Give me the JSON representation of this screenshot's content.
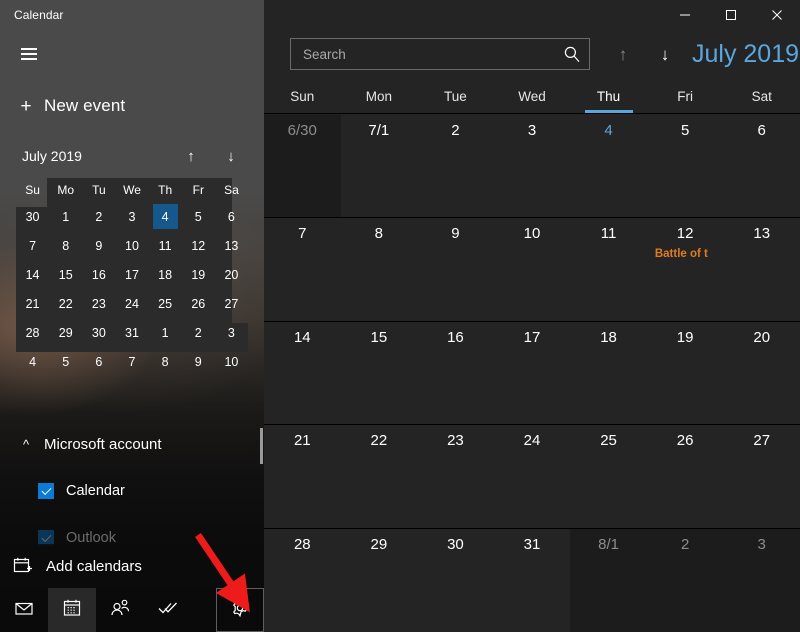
{
  "app": {
    "title": "Calendar",
    "menu_icon": "hamburger-icon",
    "new_event_label": "New event",
    "new_event_icon": "plus-icon"
  },
  "window_controls": {
    "minimize": "—",
    "maximize": "□",
    "close": "✕"
  },
  "search": {
    "placeholder": "Search",
    "value": "",
    "icon": "search-icon"
  },
  "header": {
    "prev_icon": "arrow-up-icon",
    "next_icon": "arrow-down-icon",
    "month_title": "July 2019",
    "accent_color": "#5aa7e0"
  },
  "mini_calendar": {
    "title": "July 2019",
    "prev_icon": "arrow-up-icon",
    "next_icon": "arrow-down-icon",
    "prev_glyph": "↑",
    "next_glyph": "↓",
    "weekdays": [
      "Su",
      "Mo",
      "Tu",
      "We",
      "Th",
      "Fr",
      "Sa"
    ],
    "today": "4",
    "today_color": "#17588c",
    "weeks": [
      [
        {
          "d": "30",
          "cur": false
        },
        {
          "d": "1",
          "cur": true
        },
        {
          "d": "2",
          "cur": true
        },
        {
          "d": "3",
          "cur": true
        },
        {
          "d": "4",
          "cur": true,
          "today": true
        },
        {
          "d": "5",
          "cur": true
        },
        {
          "d": "6",
          "cur": true
        }
      ],
      [
        {
          "d": "7",
          "cur": true
        },
        {
          "d": "8",
          "cur": true
        },
        {
          "d": "9",
          "cur": true
        },
        {
          "d": "10",
          "cur": true
        },
        {
          "d": "11",
          "cur": true
        },
        {
          "d": "12",
          "cur": true
        },
        {
          "d": "13",
          "cur": true
        }
      ],
      [
        {
          "d": "14",
          "cur": true
        },
        {
          "d": "15",
          "cur": true
        },
        {
          "d": "16",
          "cur": true
        },
        {
          "d": "17",
          "cur": true
        },
        {
          "d": "18",
          "cur": true
        },
        {
          "d": "19",
          "cur": true
        },
        {
          "d": "20",
          "cur": true
        }
      ],
      [
        {
          "d": "21",
          "cur": true
        },
        {
          "d": "22",
          "cur": true
        },
        {
          "d": "23",
          "cur": true
        },
        {
          "d": "24",
          "cur": true
        },
        {
          "d": "25",
          "cur": true
        },
        {
          "d": "26",
          "cur": true
        },
        {
          "d": "27",
          "cur": true
        }
      ],
      [
        {
          "d": "28",
          "cur": true
        },
        {
          "d": "29",
          "cur": true
        },
        {
          "d": "30",
          "cur": true
        },
        {
          "d": "31",
          "cur": true
        },
        {
          "d": "1",
          "cur": false
        },
        {
          "d": "2",
          "cur": false
        },
        {
          "d": "3",
          "cur": false
        }
      ],
      [
        {
          "d": "4",
          "cur": false
        },
        {
          "d": "5",
          "cur": false
        },
        {
          "d": "6",
          "cur": false
        },
        {
          "d": "7",
          "cur": false
        },
        {
          "d": "8",
          "cur": false
        },
        {
          "d": "9",
          "cur": false
        },
        {
          "d": "10",
          "cur": false
        }
      ]
    ]
  },
  "accounts": {
    "group_label": "Microsoft account",
    "collapse_icon": "chevron-up-icon",
    "calendars": [
      {
        "label": "Calendar",
        "checked": true,
        "color": "#0d7bd4"
      },
      {
        "label": "Outlook",
        "checked": true,
        "color": "#0d7bd4"
      }
    ]
  },
  "add_calendars": {
    "label": "Add calendars",
    "icon": "calendar-add-icon"
  },
  "bottom_nav": {
    "items": [
      {
        "name": "mail",
        "icon": "mail-icon",
        "selected": false
      },
      {
        "name": "calendar",
        "icon": "calendar-icon",
        "selected": true
      },
      {
        "name": "people",
        "icon": "people-icon",
        "selected": false
      },
      {
        "name": "tasks",
        "icon": "tasks-icon",
        "selected": false
      },
      {
        "name": "settings",
        "icon": "gear-icon",
        "selected": false,
        "focused": true
      }
    ]
  },
  "month_view": {
    "weekday_headers": [
      "Sun",
      "Mon",
      "Tue",
      "Wed",
      "Thu",
      "Fri",
      "Sat"
    ],
    "current_weekday_index": 4,
    "weeks": [
      [
        {
          "label": "6/30",
          "other": true
        },
        {
          "label": "7/1"
        },
        {
          "label": "2"
        },
        {
          "label": "3"
        },
        {
          "label": "4",
          "today": true
        },
        {
          "label": "5"
        },
        {
          "label": "6"
        }
      ],
      [
        {
          "label": "7"
        },
        {
          "label": "8"
        },
        {
          "label": "9"
        },
        {
          "label": "10"
        },
        {
          "label": "11"
        },
        {
          "label": "12",
          "event": "Battle of t"
        },
        {
          "label": "13"
        }
      ],
      [
        {
          "label": "14"
        },
        {
          "label": "15"
        },
        {
          "label": "16"
        },
        {
          "label": "17"
        },
        {
          "label": "18"
        },
        {
          "label": "19"
        },
        {
          "label": "20"
        }
      ],
      [
        {
          "label": "21"
        },
        {
          "label": "22"
        },
        {
          "label": "23"
        },
        {
          "label": "24"
        },
        {
          "label": "25"
        },
        {
          "label": "26"
        },
        {
          "label": "27"
        }
      ],
      [
        {
          "label": "28"
        },
        {
          "label": "29"
        },
        {
          "label": "30"
        },
        {
          "label": "31"
        },
        {
          "label": "8/1",
          "other": true
        },
        {
          "label": "2",
          "other": true
        },
        {
          "label": "3",
          "other": true
        }
      ]
    ],
    "event_color": "#e07c1e"
  },
  "annotation": {
    "type": "arrow",
    "color": "#ee1b1b",
    "points_to": "settings-nav-button"
  }
}
